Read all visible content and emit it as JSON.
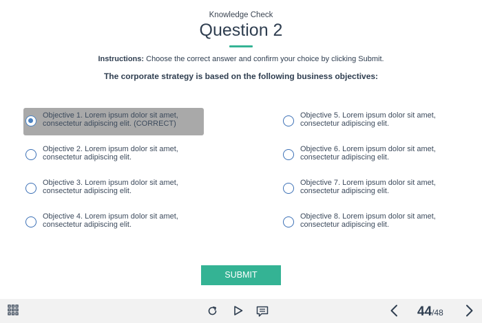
{
  "header": {
    "subtitle": "Knowledge Check",
    "title": "Question 2",
    "accent_color": "#34b394"
  },
  "instructions": {
    "label": "Instructions:",
    "text": "Choose the correct answer and confirm your choice by clicking Submit."
  },
  "question": "The corporate strategy is based on the following business objectives:",
  "options": [
    {
      "line1": "Objective 1. Lorem ipsum dolor sit amet,",
      "line2": "consectetur adipiscing elit. (CORRECT)",
      "selected": true
    },
    {
      "line1": "Objective 2. Lorem ipsum dolor sit amet,",
      "line2": "consectetur adipiscing elit.",
      "selected": false
    },
    {
      "line1": "Objective 3. Lorem ipsum dolor sit amet,",
      "line2": "consectetur adipiscing elit.",
      "selected": false
    },
    {
      "line1": "Objective 4. Lorem ipsum dolor sit amet,",
      "line2": "consectetur adipiscing elit.",
      "selected": false
    },
    {
      "line1": "Objective 5. Lorem ipsum dolor sit amet,",
      "line2": "consectetur adipiscing elit.",
      "selected": false
    },
    {
      "line1": "Objective 6. Lorem ipsum dolor sit amet,",
      "line2": "consectetur adipiscing elit.",
      "selected": false
    },
    {
      "line1": "Objective 7. Lorem ipsum dolor sit amet,",
      "line2": "consectetur adipiscing elit.",
      "selected": false
    },
    {
      "line1": "Objective 8. Lorem ipsum dolor sit amet,",
      "line2": "consectetur adipiscing elit.",
      "selected": false
    }
  ],
  "submit_label": "SUBMIT",
  "footer": {
    "icons": [
      "grid-menu-icon",
      "replay-icon",
      "play-icon",
      "notes-icon",
      "prev-icon",
      "next-icon"
    ],
    "current_page": "44",
    "total_pages": "/48"
  }
}
